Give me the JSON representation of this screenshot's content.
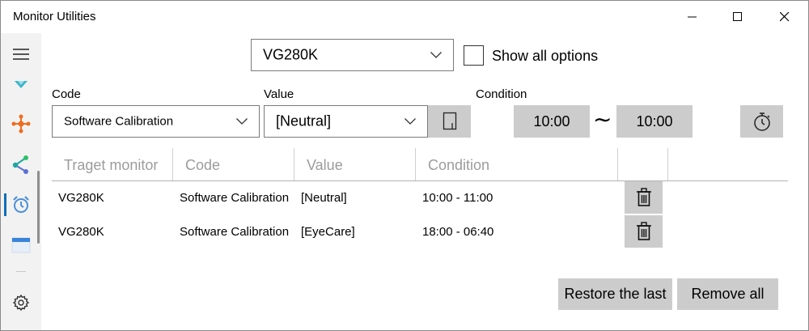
{
  "window": {
    "title": "Monitor Utilities"
  },
  "sidebar": {
    "items": [
      {
        "icon": "menu-icon"
      },
      {
        "icon": "color-filter-icon",
        "color": "#3cb4c8"
      },
      {
        "icon": "network-nodes-icon",
        "color": "#ef6c1f"
      },
      {
        "icon": "share-icon",
        "color": "#1ea7a0"
      },
      {
        "icon": "alarm-clock-icon",
        "color": "#4a90d9",
        "selected": true
      },
      {
        "icon": "window-icon",
        "color": "#3a84d8"
      },
      {
        "icon": "gear-icon"
      }
    ],
    "accent": "#0b6fb8"
  },
  "monitor_select": {
    "value": "VG280K"
  },
  "show_all_options": {
    "label": "Show all options",
    "checked": false
  },
  "form": {
    "code_label": "Code",
    "code_value": "Software Calibration",
    "value_label": "Value",
    "value_value": "[Neutral]",
    "condition_label": "Condition",
    "time_start": "10:00",
    "separator": "∼",
    "time_end": "10:00"
  },
  "table": {
    "columns": [
      "Traget monitor",
      "Code",
      "Value",
      "Condition"
    ],
    "rows": [
      {
        "monitor": "VG280K",
        "code": "Software Calibration",
        "value": "[Neutral]",
        "condition": "10:00 - 11:00"
      },
      {
        "monitor": "VG280K",
        "code": "Software Calibration",
        "value": "[EyeCare]",
        "condition": "18:00 - 06:40"
      }
    ]
  },
  "footer": {
    "restore_label": "Restore the last",
    "remove_all_label": "Remove all"
  },
  "colors": {
    "button_bg": "#cccccc",
    "header_text": "#9c9c9c"
  }
}
